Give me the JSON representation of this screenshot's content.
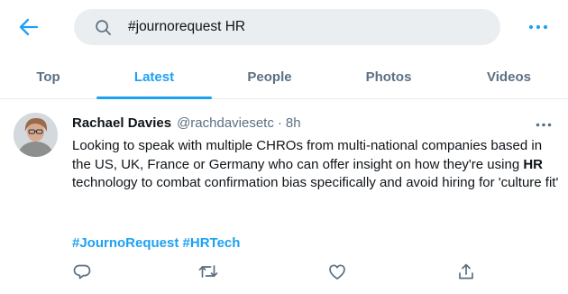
{
  "header": {
    "back_icon": "arrow-left-icon",
    "search": {
      "value": "#journorequest HR",
      "icon": "search-icon"
    },
    "more_icon": "more-horizontal-icon"
  },
  "tabs": [
    {
      "label": "Top",
      "active": false
    },
    {
      "label": "Latest",
      "active": true
    },
    {
      "label": "People",
      "active": false
    },
    {
      "label": "Photos",
      "active": false
    },
    {
      "label": "Videos",
      "active": false
    }
  ],
  "tweet": {
    "author_name": "Rachael Davies",
    "author_handle": "@rachdaviesetc",
    "separator": "·",
    "time": "8h",
    "text_before": "Looking to speak with multiple CHROs from multi-national companies based in the US, UK, France or Germany who can offer insight on how they're using ",
    "text_bold": "HR",
    "text_after": " technology to combat confirmation bias specifically and avoid hiring for  'culture fit'",
    "hashtags": [
      "#JournoRequest",
      "#HRTech"
    ],
    "actions": [
      "reply-icon",
      "retweet-icon",
      "like-icon",
      "share-icon"
    ]
  },
  "colors": {
    "accent": "#1da1f2",
    "text_primary": "#0f1419",
    "text_secondary": "#5b7083",
    "search_bg": "#ebeef0"
  }
}
